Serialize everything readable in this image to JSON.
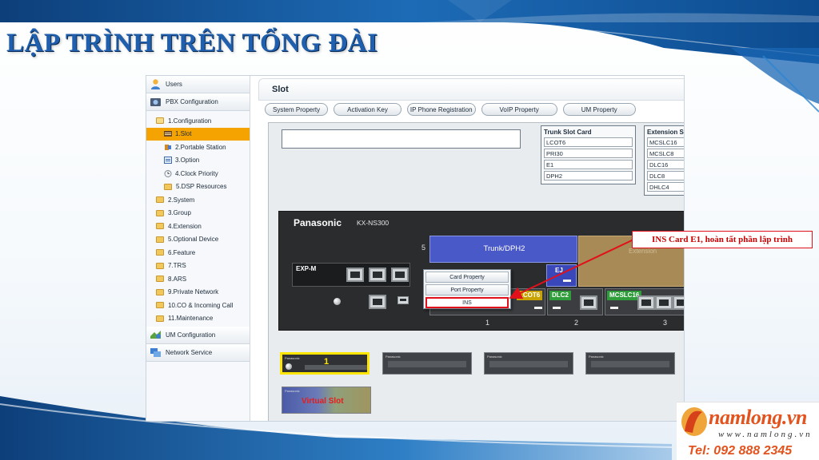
{
  "slide": {
    "title": "LẬP TRÌNH TRÊN TỔNG ĐÀI",
    "annotation": "INS Card E1, hoàn tất phần lập trình"
  },
  "sidebar": {
    "sections": [
      {
        "label": "Users",
        "icon": "user-icon"
      },
      {
        "label": "PBX Configuration",
        "icon": "pbx-icon"
      }
    ],
    "tree": [
      {
        "label": "1.Configuration",
        "level": 1,
        "icon": "folder-open-icon"
      },
      {
        "label": "1.Slot",
        "level": 2,
        "icon": "slot-icon",
        "selected": true
      },
      {
        "label": "2.Portable Station",
        "level": 2,
        "icon": "station-icon"
      },
      {
        "label": "3.Option",
        "level": 2,
        "icon": "option-icon"
      },
      {
        "label": "4.Clock Priority",
        "level": 2,
        "icon": "clock-icon"
      },
      {
        "label": "5.DSP Resources",
        "level": 2,
        "icon": "folder-icon"
      },
      {
        "label": "2.System",
        "level": 1,
        "icon": "folder-icon"
      },
      {
        "label": "3.Group",
        "level": 1,
        "icon": "folder-icon"
      },
      {
        "label": "4.Extension",
        "level": 1,
        "icon": "folder-icon"
      },
      {
        "label": "5.Optional Device",
        "level": 1,
        "icon": "folder-icon"
      },
      {
        "label": "6.Feature",
        "level": 1,
        "icon": "folder-icon"
      },
      {
        "label": "7.TRS",
        "level": 1,
        "icon": "folder-icon"
      },
      {
        "label": "8.ARS",
        "level": 1,
        "icon": "folder-icon"
      },
      {
        "label": "9.Private Network",
        "level": 1,
        "icon": "folder-icon"
      },
      {
        "label": "10.CO & Incoming Call",
        "level": 1,
        "icon": "folder-icon"
      },
      {
        "label": "11.Maintenance",
        "level": 1,
        "icon": "folder-icon"
      }
    ],
    "footer_sections": [
      {
        "label": "UM Configuration",
        "icon": "um-icon"
      },
      {
        "label": "Network Service",
        "icon": "network-icon"
      }
    ]
  },
  "main": {
    "title": "Slot",
    "buttons": [
      "System Property",
      "Activation Key",
      "IP Phone Registration",
      "VoIP Property",
      "UM Property"
    ],
    "trunk_list": {
      "header": "Trunk Slot Card",
      "items": [
        "LCOT6",
        "PRI30",
        "E1",
        "DPH2"
      ]
    },
    "extension_list": {
      "header": "Extension Sl",
      "items": [
        "MCSLC16",
        "MCSLC8",
        "DLC16",
        "DLC8",
        "DHLC4"
      ]
    },
    "cabinet": {
      "brand": "Panasonic",
      "model": "KX-NS300",
      "exp_label": "EXP-M",
      "trunk_slot_label": "Trunk/DPH2",
      "ej_label": "EJ",
      "upper_slot_number": "5",
      "lower_cards": [
        "LCOT6",
        "DLC2",
        "MCSLC16"
      ],
      "slot_numbers": [
        "1",
        "2",
        "3"
      ]
    },
    "context_menu": {
      "items": [
        "Card Property",
        "Port Property",
        "INS"
      ],
      "highlighted": "INS"
    },
    "thumbnails": {
      "selected_number": "1",
      "virtual_label": "Virtual Slot"
    }
  },
  "logo": {
    "name": "namlong.vn",
    "website": "www.namlong.vn",
    "phone": "Tel: 092 888 2345"
  },
  "colors": {
    "title_blue": "#1f5fae",
    "selected_orange": "#f5a300",
    "highlight_red": "#e1101a",
    "logo_orange": "#e3531e",
    "trunk_slot_blue": "#4a59c8"
  }
}
